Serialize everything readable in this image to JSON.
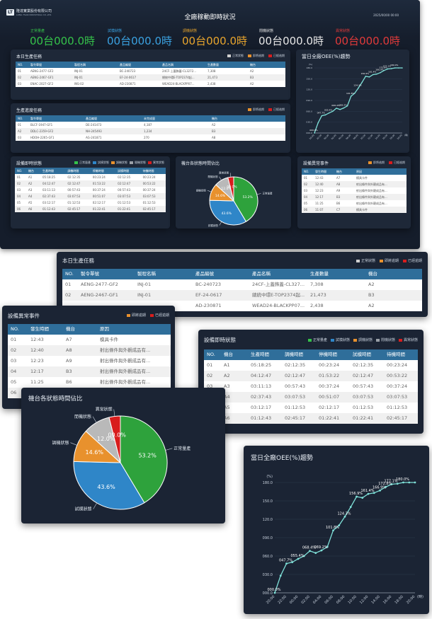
{
  "header": {
    "company": "隆達實業股份有限公司",
    "company_en": "LONG TSAN INDUSTRIAL CO.,LTD.",
    "logo": "LT",
    "title": "全廠稼動即時狀況",
    "datetime": "2025/00/00 00:00"
  },
  "statuses": [
    {
      "label": "正常量產",
      "value": "00台000.0時",
      "color": "#35c24a"
    },
    {
      "label": "試模狀態",
      "value": "00台000.0時",
      "color": "#3aa1e0"
    },
    {
      "label": "調機狀態",
      "value": "00台000.0時",
      "color": "#e8a52d"
    },
    {
      "label": "閒機狀態",
      "value": "00台000.0時",
      "color": "#e6e6e6"
    },
    {
      "label": "異常狀態",
      "value": "00台000.0時",
      "color": "#e03a3a"
    }
  ],
  "production": {
    "title": "本日生產任務",
    "legend": [
      "正常狀態",
      "即將逾期",
      "已經逾期"
    ],
    "legend_colors": [
      "#cfcfcf",
      "#e8912d",
      "#d81d1d"
    ],
    "headers": [
      "NO.",
      "製令單號",
      "製程名稱",
      "產品編號",
      "產品名稱",
      "生產數量",
      "機台"
    ],
    "rows": [
      {
        "no": "01",
        "order": "AENG-2477-GF2",
        "process": "INJ-01",
        "code": "BC-240723",
        "name": "24CF-上蓋飾蓋-CL3272...",
        "qty": "7,308",
        "machine": "A2",
        "cls": "c-gray"
      },
      {
        "no": "02",
        "order": "AENG-2467-GF1",
        "process": "INJ-01",
        "code": "EF-24-0617",
        "name": "總統中環E-TOP2374起...",
        "qty": "21,473",
        "machine": "B3",
        "cls": "c-orange"
      },
      {
        "no": "03",
        "order": "ENAC-2027-GF2",
        "process": "INS-02",
        "code": "AD-230871",
        "name": "WEAD24-BLACKPP07...",
        "qty": "2,438",
        "machine": "A2",
        "cls": "c-red"
      }
    ],
    "zoom_rows": [
      {
        "no": "01",
        "order": "AENG-2477-GF2",
        "process": "INJ-01",
        "code": "BC-240723",
        "name": "24CF-上蓋飾蓋-CL327...",
        "qty": "7,308",
        "machine": "A2",
        "cls": "c-gray"
      },
      {
        "no": "02",
        "order": "AENG-2467-GF1",
        "process": "INJ-01",
        "code": "EF-24-0617",
        "name": "總統中環E-TOP2374起...",
        "qty": "21,473",
        "machine": "B3",
        "cls": "c-orange"
      },
      {
        "no": "",
        "order": "",
        "process": "",
        "code": "AD-230871",
        "name": "WEAD24-BLACKPP07...",
        "qty": "2,438",
        "machine": "A2",
        "cls": "c-red"
      }
    ]
  },
  "progress": {
    "title": "生產進度任務",
    "legend": [
      "即將逾期",
      "已經逾期"
    ],
    "legend_colors": [
      "#e8912d",
      "#d81d1d"
    ],
    "headers": [
      "NO.",
      "製令單號",
      "產品編號",
      "未完成量",
      "機台"
    ],
    "rows": [
      {
        "no": "01",
        "order": "BLCF-1947-GF1",
        "code": "DE-241473",
        "qty": "4,187",
        "machine": "A2",
        "cls": "c-red"
      },
      {
        "no": "A2",
        "order": "DDLC-2359-GF2",
        "code": "NH-245493",
        "qty": "1,234",
        "machine": "B3",
        "cls": "c-red"
      },
      {
        "no": "03",
        "order": "HDOH-2265-GF1",
        "code": "AG-241871",
        "qty": "270",
        "machine": "A8",
        "cls": "c-orange"
      }
    ]
  },
  "machines": {
    "title": "設備即時狀態",
    "legend": [
      "正常量產",
      "試模狀態",
      "調機狀態",
      "閒機狀態",
      "異常狀態"
    ],
    "legend_colors": [
      "#35c24a",
      "#2f86c8",
      "#e8912d",
      "#9aa0a8",
      "#d81d1d"
    ],
    "headers": [
      "NO.",
      "機台",
      "生產時間",
      "調機時間",
      "停機時間",
      "試模時間",
      "待機時間"
    ],
    "rows": [
      {
        "no": "01",
        "m": "A1",
        "t1": "05:18:25",
        "t2": "02:12:35",
        "t3": "00:23:24",
        "t4": "02:12:35",
        "t5": "00:23:24",
        "cls": "c-green"
      },
      {
        "no": "02",
        "m": "A2",
        "t1": "04:12:47",
        "t2": "02:12:47",
        "t3": "01:53:22",
        "t4": "02:12:47",
        "t5": "00:53:22",
        "cls": "c-gray"
      },
      {
        "no": "03",
        "m": "A3",
        "t1": "03:11:13",
        "t2": "00:57:43",
        "t3": "00:37:24",
        "t4": "00:57:43",
        "t5": "00:37:24",
        "cls": "c-gray"
      },
      {
        "no": "04",
        "m": "A4",
        "t1": "02:37:43",
        "t2": "03:07:53",
        "t3": "00:51:07",
        "t4": "03:07:53",
        "t5": "03:07:53",
        "cls": "c-blue"
      },
      {
        "no": "05",
        "m": "A5",
        "t1": "03:12:17",
        "t2": "01:12:53",
        "t3": "02:12:17",
        "t4": "01:12:53",
        "t5": "01:12:53",
        "cls": "c-gray"
      },
      {
        "no": "06",
        "m": "A6",
        "t1": "01:12:43",
        "t2": "02:45:17",
        "t3": "01:22:41",
        "t4": "01:22:41",
        "t5": "02:45:17",
        "cls": "c-gray"
      }
    ]
  },
  "pie": {
    "title": "機台各狀態時間佔比",
    "slices": [
      {
        "label": "正常量產",
        "value": 53.2,
        "text": "53.2%",
        "color": "#2ea23c"
      },
      {
        "label": "試模狀態",
        "value": 43.6,
        "text": "43.6%",
        "color": "#2f86c8"
      },
      {
        "label": "調機狀態",
        "value": 14.6,
        "text": "14.6%",
        "color": "#e8912d"
      },
      {
        "label": "閒機狀態",
        "value": 12.0,
        "text": "12.0%",
        "color": "#b9b9b9"
      },
      {
        "label": "異常狀態",
        "value": 0.0,
        "text": "00.0%",
        "color": "#d81d1d"
      }
    ]
  },
  "abnormal": {
    "title": "設備異常事件",
    "legend": [
      "即將逾期",
      "已經逾期"
    ],
    "legend_colors": [
      "#e8912d",
      "#d81d1d"
    ],
    "headers": [
      "NO.",
      "發生時間",
      "機台",
      "原因"
    ],
    "rows": [
      {
        "no": "01",
        "time": "12:43",
        "m": "A7",
        "reason": "模具卡件",
        "cls": "c-red"
      },
      {
        "no": "02",
        "time": "12:40",
        "m": "A8",
        "reason": "射出條件與外觀成品有...",
        "cls": "c-orange"
      },
      {
        "no": "03",
        "time": "12:23",
        "m": "A9",
        "reason": "射出條件與外觀成品有...",
        "cls": "c-red"
      },
      {
        "no": "04",
        "time": "12:17",
        "m": "B3",
        "reason": "射出條件與外觀成品有...",
        "cls": "c-orange"
      },
      {
        "no": "05",
        "time": "11:25",
        "m": "B6",
        "reason": "射出條件與外觀成品有...",
        "cls": "c-orange"
      },
      {
        "no": "06",
        "time": "11:07",
        "m": "C7",
        "reason": "模具卡件",
        "cls": "c-red"
      }
    ]
  },
  "chart_data": {
    "type": "line",
    "title": "當日全廠OEE(%)趨勢",
    "ylabel": "(%)",
    "xlabel": "(時)",
    "ylim": [
      0,
      180
    ],
    "yticks": [
      "000.0",
      "030.0",
      "060.0",
      "090.0",
      "120.0",
      "150.0",
      "180.0"
    ],
    "xticks": [
      "20:00",
      "22:00",
      "00:00",
      "02:00",
      "04:00",
      "06:00",
      "08:00",
      "10:00",
      "12:00",
      "14:00",
      "16:00",
      "18:00",
      "20:00"
    ],
    "series": [
      {
        "color": "#7fe0d8",
        "x": [
          0,
          0.5,
          1,
          1.5,
          2,
          2.5,
          3,
          3.5,
          4,
          4.5,
          5,
          5.5,
          6,
          6.5,
          7,
          7.5,
          8,
          8.5,
          9,
          9.5,
          10,
          10.5,
          11,
          11.5,
          12
        ],
        "y": [
          0.0,
          28.0,
          47.7,
          50.0,
          55.4,
          60.0,
          68.4,
          65.0,
          69.2,
          75.0,
          101.8,
          110.0,
          124.3,
          140.0,
          156.9,
          155.0,
          161.4,
          163.0,
          166.9,
          172.8,
          177.1,
          178.0,
          180.0,
          180.0,
          180.0
        ],
        "labels": [
          {
            "i": 2,
            "text": "047.7%"
          },
          {
            "i": 4,
            "text": "055.4%"
          },
          {
            "i": 6,
            "text": "068.4%"
          },
          {
            "i": 8,
            "text": "069.2%"
          },
          {
            "i": 10,
            "text": "101.8%"
          },
          {
            "i": 12,
            "text": "124.3%"
          },
          {
            "i": 14,
            "text": "156.9%"
          },
          {
            "i": 16,
            "text": "161.4%"
          },
          {
            "i": 18,
            "text": "166.9%"
          },
          {
            "i": 19,
            "text": "172.8%"
          },
          {
            "i": 20,
            "text": "177.1%"
          },
          {
            "i": 22,
            "text": "180.0%"
          },
          {
            "i": 0,
            "text": "000.0%"
          }
        ]
      }
    ]
  }
}
